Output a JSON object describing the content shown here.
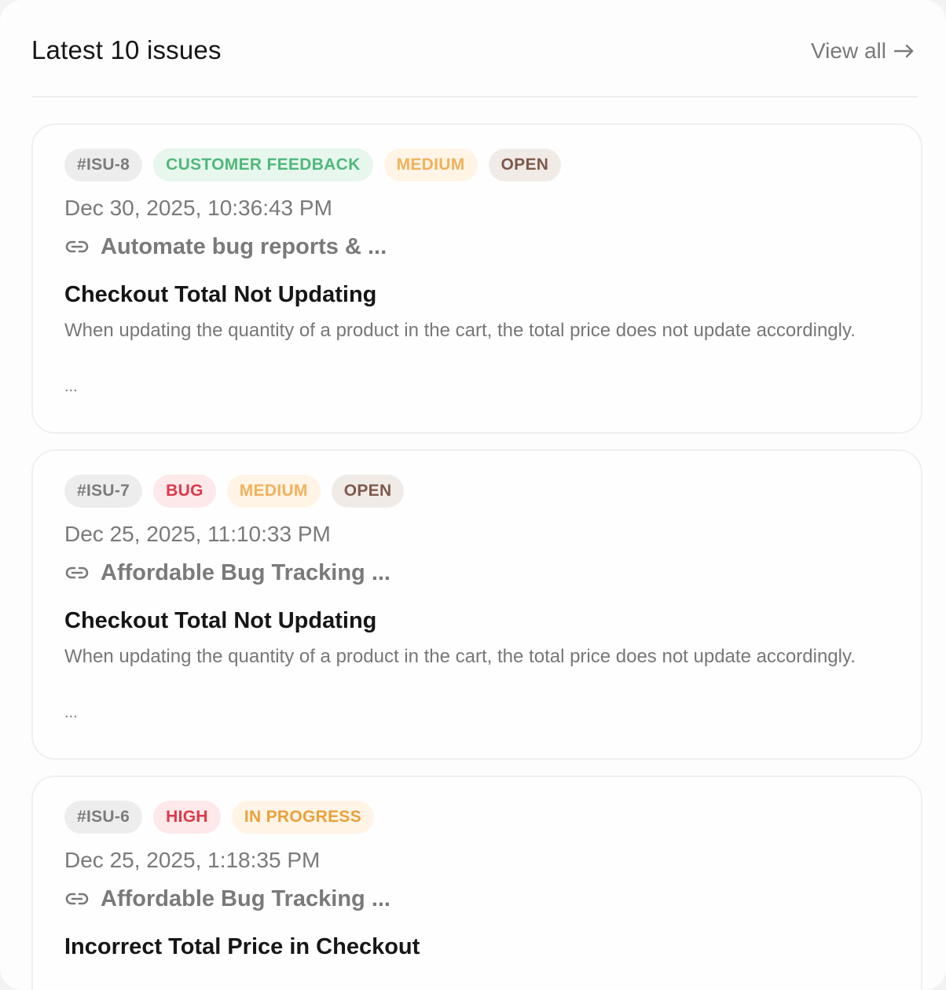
{
  "header": {
    "title": "Latest 10 issues",
    "view_all_label": "View all"
  },
  "issues": [
    {
      "id": "#ISU-8",
      "tags": [
        "CUSTOMER FEEDBACK",
        "MEDIUM",
        "OPEN"
      ],
      "date": "Dec 30, 2025, 10:36:43 PM",
      "project": "Automate bug reports & ...",
      "title": "Checkout Total Not Updating",
      "description": "When updating the quantity of a product in the cart, the total price does not update accordingly.",
      "more": "..."
    },
    {
      "id": "#ISU-7",
      "tags": [
        "BUG",
        "MEDIUM",
        "OPEN"
      ],
      "date": "Dec 25, 2025, 11:10:33 PM",
      "project": "Affordable Bug Tracking ...",
      "title": "Checkout Total Not Updating",
      "description": "When updating the quantity of a product in the cart, the total price does not update accordingly.",
      "more": "..."
    },
    {
      "id": "#ISU-6",
      "tags": [
        "HIGH",
        "IN PROGRESS"
      ],
      "date": "Dec 25, 2025, 1:18:35 PM",
      "project": "Affordable Bug Tracking ...",
      "title": "Incorrect Total Price in Checkout"
    }
  ],
  "icons": {
    "view_all": "arrow-right-icon",
    "project": "link-icon"
  },
  "colors": {
    "feedback": "#4fb87b",
    "medium": "#f0b15b",
    "open": "#7e5a4b",
    "bug": "#dc3a48",
    "high": "#dc3a48",
    "in_progress": "#e9a23c"
  }
}
